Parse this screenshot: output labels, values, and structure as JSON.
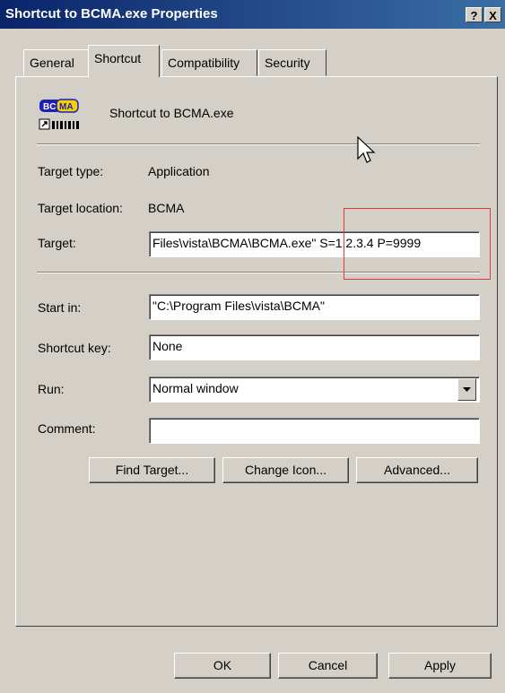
{
  "window": {
    "title": "Shortcut to BCMA.exe Properties",
    "help_btn": "?",
    "close_btn": "X"
  },
  "tabs": [
    {
      "label": "General"
    },
    {
      "label": "Shortcut"
    },
    {
      "label": "Compatibility"
    },
    {
      "label": "Security"
    }
  ],
  "header": {
    "icon_text": "BCMA",
    "name": "Shortcut to BCMA.exe"
  },
  "fields": {
    "target_type_label": "Target type:",
    "target_type_value": "Application",
    "target_location_label": "Target location:",
    "target_location_value": "BCMA",
    "target_label": "Target:",
    "target_value": "Files\\vista\\BCMA\\BCMA.exe\" S=1.2.3.4 P=9999",
    "start_in_label": "Start in:",
    "start_in_value": "\"C:\\Program Files\\vista\\BCMA\"",
    "shortcut_key_label": "Shortcut key:",
    "shortcut_key_value": "None",
    "run_label": "Run:",
    "run_value": "Normal window",
    "comment_label": "Comment:",
    "comment_value": ""
  },
  "buttons": {
    "find_target": "Find Target...",
    "change_icon": "Change Icon...",
    "advanced": "Advanced...",
    "ok": "OK",
    "cancel": "Cancel",
    "apply": "Apply"
  },
  "colors": {
    "title_start": "#0a246a",
    "title_end": "#3a6ea5",
    "face": "#d4d0c8",
    "highlight_box": "#e53935"
  }
}
